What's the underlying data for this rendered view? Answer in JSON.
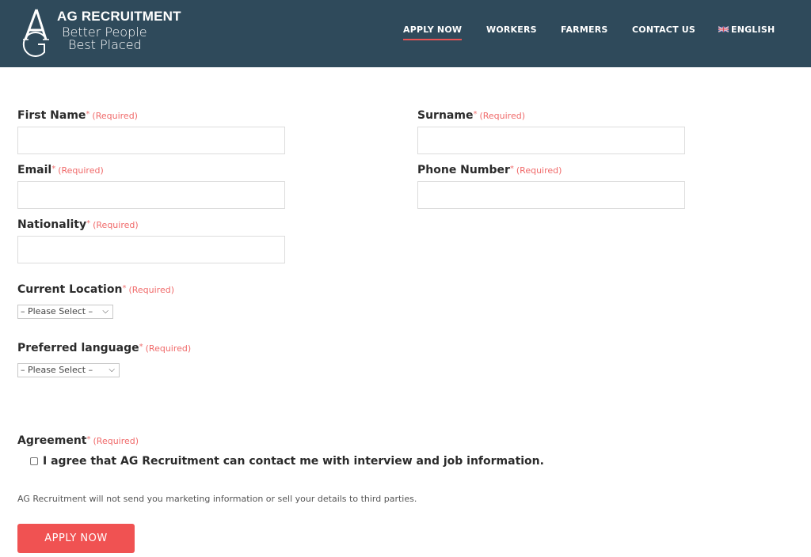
{
  "brand": {
    "title": "AG RECRUITMENT",
    "tagline_line1": "Better People",
    "tagline_line2": "Best Placed",
    "logo_icon": "ag-monogram-icon"
  },
  "nav": {
    "items": [
      {
        "label": "APPLY NOW",
        "active": true
      },
      {
        "label": "WORKERS",
        "active": false
      },
      {
        "label": "FARMERS",
        "active": false
      },
      {
        "label": "CONTACT US",
        "active": false
      },
      {
        "label": "ENGLISH",
        "active": false,
        "icon": "uk-flag-icon"
      }
    ]
  },
  "form": {
    "required_star": "*",
    "required_text": "(Required)",
    "fields": {
      "first_name": {
        "label": "First Name",
        "value": ""
      },
      "surname": {
        "label": "Surname",
        "value": ""
      },
      "email": {
        "label": "Email",
        "value": ""
      },
      "phone": {
        "label": "Phone Number",
        "value": ""
      },
      "nationality": {
        "label": "Nationality",
        "value": ""
      },
      "current_location": {
        "label": "Current Location",
        "selected": "– Please Select –"
      },
      "preferred_language": {
        "label": "Preferred language",
        "selected": "– Please Select –"
      }
    },
    "agreement": {
      "label": "Agreement",
      "checkbox_text": "I agree that AG Recruitment can contact me with interview and job information.",
      "checked": false
    },
    "privacy_note": "AG Recruitment will not send you marketing information or sell your details to third parties.",
    "submit_label": "APPLY NOW"
  },
  "colors": {
    "header_bg": "#2f4a5b",
    "accent": "#f05252",
    "required": "#f06a6a"
  }
}
